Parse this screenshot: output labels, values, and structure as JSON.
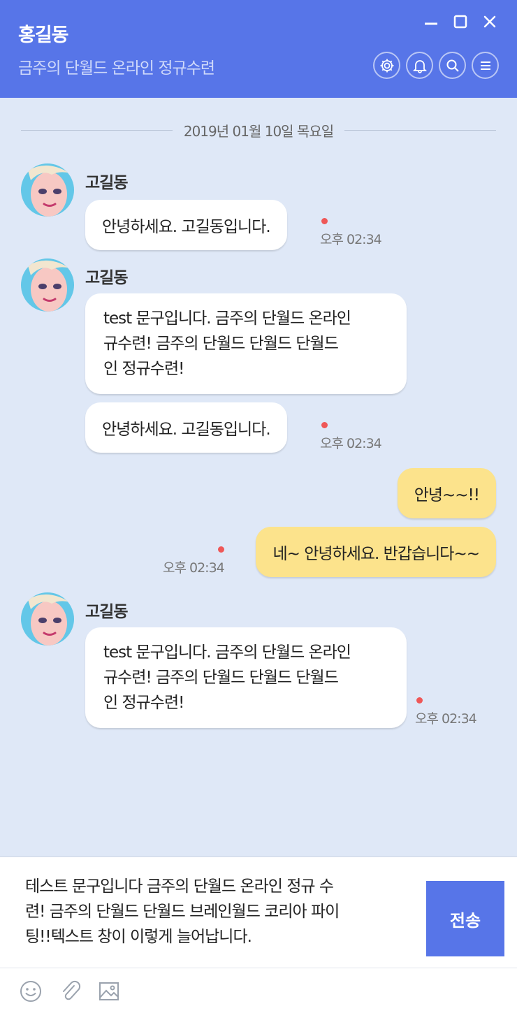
{
  "header": {
    "title": "홍길동",
    "subtitle": "금주의 단월드 온라인 정규수련",
    "icons": [
      "gear-icon",
      "bell-icon",
      "search-icon",
      "menu-icon"
    ],
    "window_controls": [
      "minimize-icon",
      "maximize-icon",
      "close-icon"
    ]
  },
  "date_separator": "2019년 01월 10일 목요일",
  "messages": [
    {
      "direction": "in",
      "sender": "고길동",
      "text": "안녕하세요. 고길동입니다.",
      "time": "오후 02:34"
    },
    {
      "direction": "in",
      "sender": "고길동",
      "text_lines": [
        "test 문구입니다. 금주의 단월드 온라인",
        "규수련! 금주의 단월드 단월드 단월드",
        "인 정규수련!"
      ]
    },
    {
      "direction": "in",
      "text": "안녕하세요. 고길동입니다.",
      "time": "오후 02:34"
    },
    {
      "direction": "out",
      "text": "안녕~~!!"
    },
    {
      "direction": "out",
      "text": "네~ 안녕하세요. 반갑습니다~~",
      "time": "오후 02:34"
    },
    {
      "direction": "in",
      "sender": "고길동",
      "text_lines": [
        "test 문구입니다. 금주의 단월드 온라인",
        "규수련! 금주의 단월드 단월드 단월드",
        "인 정규수련!"
      ],
      "time": "오후 02:34"
    }
  ],
  "composer": {
    "lines": [
      "테스트 문구입니다 금주의 단월드 온라인 정규 수",
      "련! 금주의 단월드 단월드 브레인월드 코리아 파이",
      "팅!!텍스트 창이 이렇게 늘어납니다."
    ],
    "send_label": "전송",
    "tools": [
      "emoji-icon",
      "attachment-icon",
      "image-icon"
    ]
  },
  "colors": {
    "header_bg": "#5775e8",
    "chat_bg": "#dfe8f7",
    "outgoing_bubble": "#fce38c",
    "incoming_bubble": "#ffffff",
    "unread_dot": "#ef5757"
  }
}
